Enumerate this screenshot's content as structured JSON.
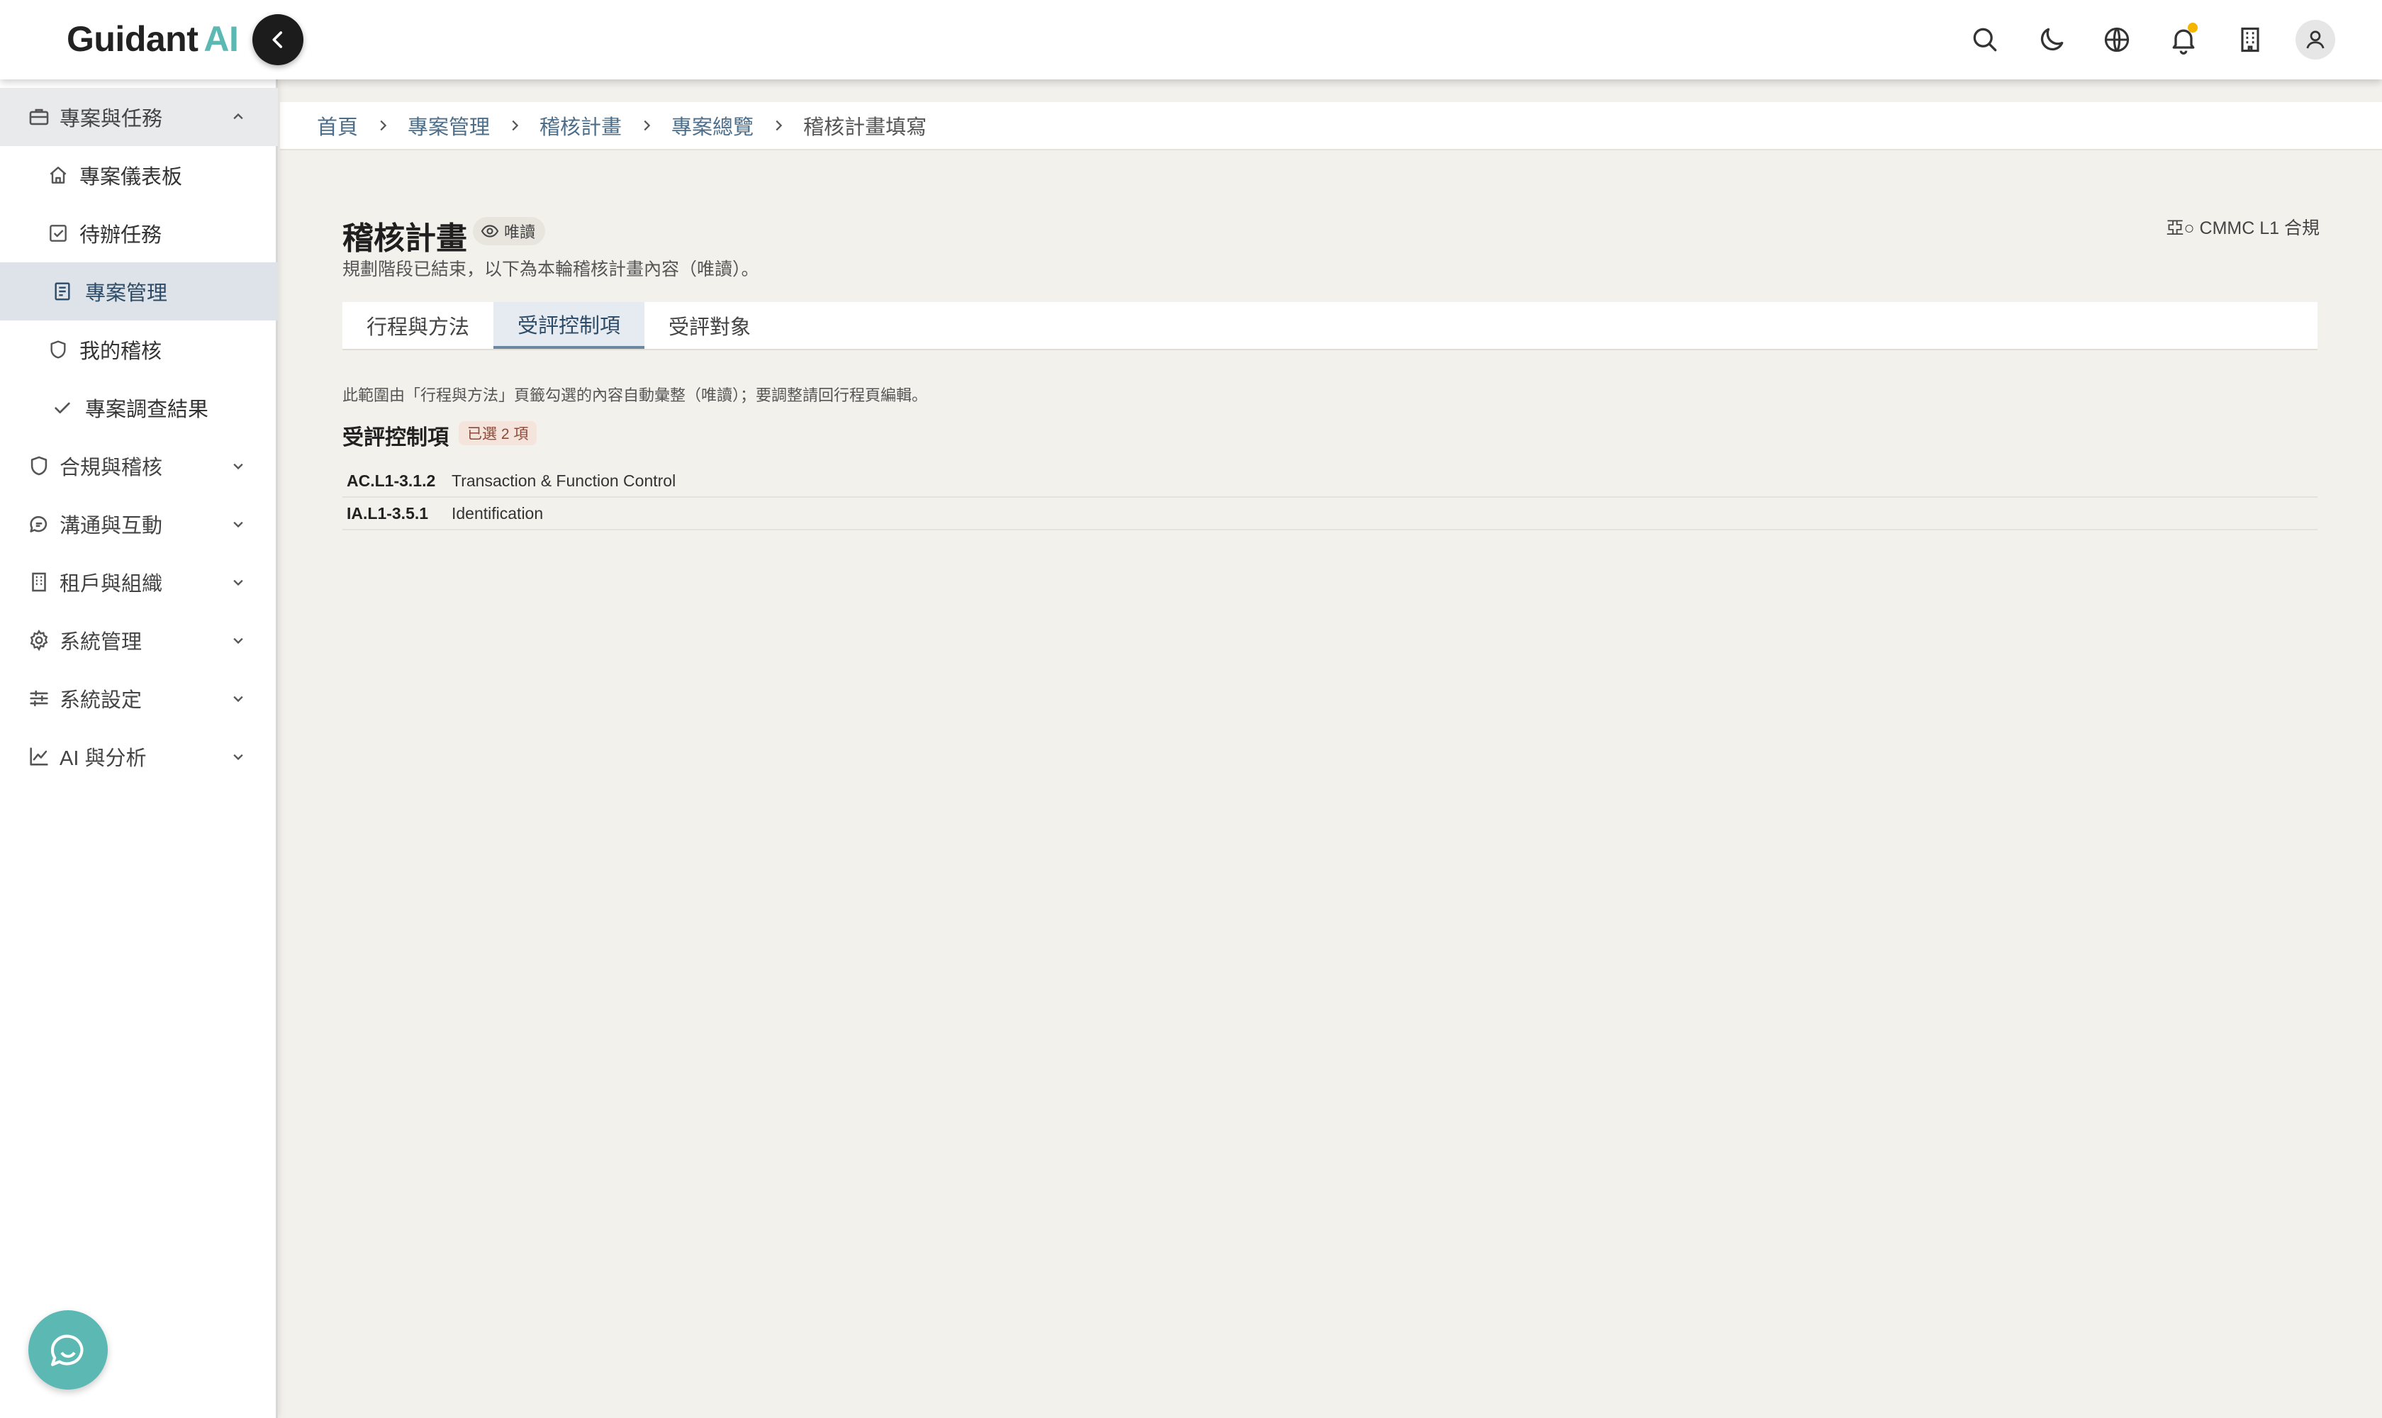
{
  "brand": {
    "name": "Guidant",
    "accent_word": "AI",
    "accent_color": "#5cb8b2"
  },
  "header": {
    "icons": [
      "search-icon",
      "moon-icon",
      "globe-icon",
      "bell-icon",
      "building-icon",
      "user-icon"
    ]
  },
  "sidebar": {
    "groups": [
      {
        "label": "專案與任務",
        "icon": "briefcase-icon",
        "expanded": true
      },
      {
        "label": "合規與稽核",
        "icon": "shield-icon",
        "expanded": false
      },
      {
        "label": "溝通與互動",
        "icon": "chat-icon",
        "expanded": false
      },
      {
        "label": "租戶與組織",
        "icon": "building-icon",
        "expanded": false
      },
      {
        "label": "系統管理",
        "icon": "gear-icon",
        "expanded": false
      },
      {
        "label": "系統設定",
        "icon": "sliders-icon",
        "expanded": false
      },
      {
        "label": "AI 與分析",
        "icon": "chart-icon",
        "expanded": false
      }
    ],
    "items": [
      {
        "label": "專案儀表板",
        "icon": "home-icon"
      },
      {
        "label": "待辦任務",
        "icon": "checkbox-icon"
      },
      {
        "label": "專案管理",
        "icon": "document-icon",
        "selected": true
      },
      {
        "label": "我的稽核",
        "icon": "shield-icon"
      },
      {
        "label": "專案調查結果",
        "icon": "check-icon"
      }
    ]
  },
  "breadcrumb": [
    "首頁",
    "專案管理",
    "稽核計畫",
    "專案總覽",
    "稽核計畫填寫"
  ],
  "page": {
    "title": "稽核計畫",
    "readonly_badge": "唯讀",
    "subtitle": "規劃階段已結束，以下為本輪稽核計畫內容（唯讀）。",
    "framework": "亞○ CMMC L1 合規"
  },
  "tabs": [
    {
      "label": "行程與方法",
      "active": false
    },
    {
      "label": "受評控制項",
      "active": true
    },
    {
      "label": "受評對象",
      "active": false
    }
  ],
  "scope": {
    "note": "此範圍由「行程與方法」頁籤勾選的內容自動彙整（唯讀）；要調整請回行程頁編輯。",
    "section_title": "受評控制項",
    "count_label": "已選 2 項",
    "controls": [
      {
        "id": "AC.L1-3.1.2",
        "name": "Transaction & Function Control"
      },
      {
        "id": "IA.L1-3.5.1",
        "name": "Identification"
      }
    ]
  }
}
